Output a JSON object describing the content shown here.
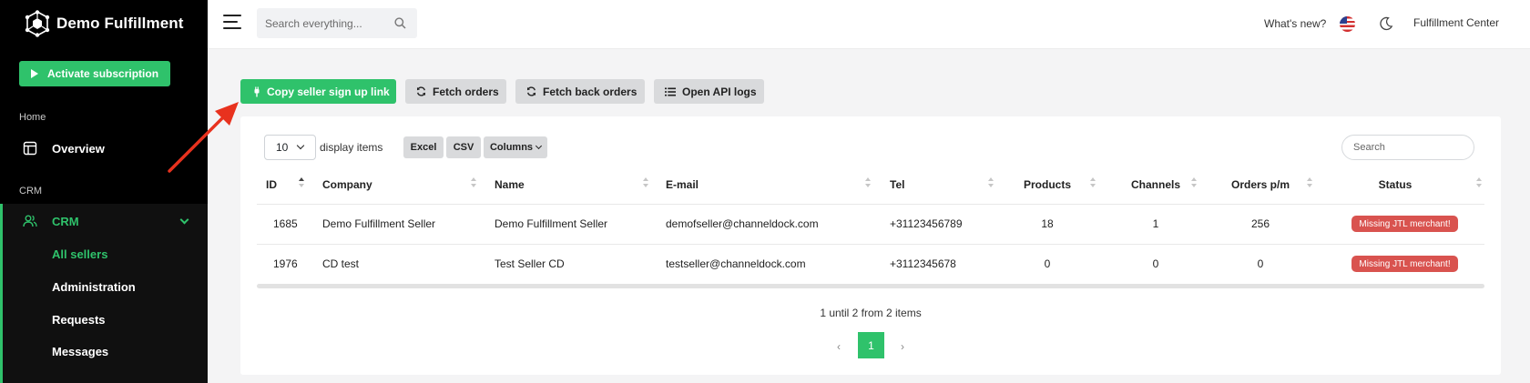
{
  "brand": {
    "name": "Demo Fulfillment"
  },
  "sidebar": {
    "activate_label": "Activate subscription",
    "section_home": "Home",
    "overview_label": "Overview",
    "section_crm": "CRM",
    "crm_label": "CRM",
    "items": [
      "All sellers",
      "Administration",
      "Requests",
      "Messages"
    ],
    "active_item": "All sellers"
  },
  "topbar": {
    "search_placeholder": "Search everything...",
    "whats_new": "What's new?",
    "account_label": "Fulfillment Center"
  },
  "actions": {
    "copy_link": "Copy seller sign up link",
    "fetch_orders": "Fetch orders",
    "fetch_back_orders": "Fetch back orders",
    "open_api_logs": "Open API logs"
  },
  "table_controls": {
    "page_length": "10",
    "display_items": "display items",
    "excel": "Excel",
    "csv": "CSV",
    "columns": "Columns",
    "search_placeholder": "Search"
  },
  "table": {
    "columns": [
      "ID",
      "Company",
      "Name",
      "E-mail",
      "Tel",
      "Products",
      "Channels",
      "Orders p/m",
      "Status"
    ],
    "rows": [
      {
        "id": "1685",
        "company": "Demo Fulfillment Seller",
        "name": "Demo Fulfillment Seller",
        "email": "demofseller@channeldock.com",
        "tel": "+31123456789",
        "products": "18",
        "channels": "1",
        "orders": "256",
        "status": "Missing JTL merchant!"
      },
      {
        "id": "1976",
        "company": "CD test",
        "name": "Test Seller CD",
        "email": "testseller@channeldock.com",
        "tel": "+3112345678",
        "products": "0",
        "channels": "0",
        "orders": "0",
        "status": "Missing JTL merchant!"
      }
    ]
  },
  "pagination": {
    "info": "1 until 2 from 2 items",
    "prev": "‹",
    "current": "1",
    "next": "›"
  },
  "colors": {
    "accent": "#2fc26b",
    "sidebar_bg": "#000000",
    "badge_danger": "#d9534f",
    "annotation_arrow": "#e8321e"
  }
}
